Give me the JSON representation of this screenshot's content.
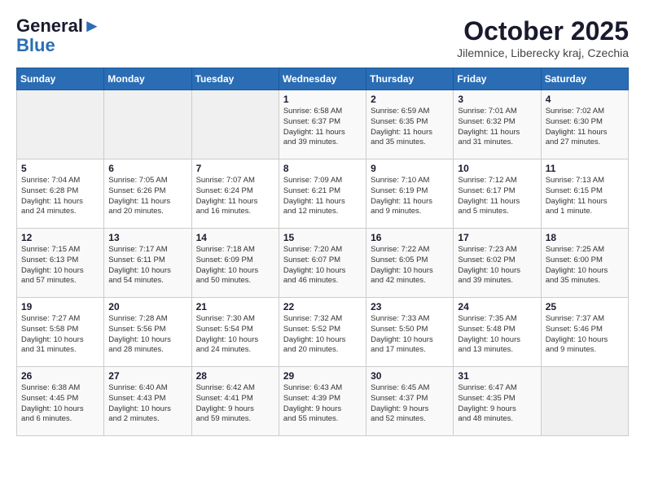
{
  "logo": {
    "line1": "General",
    "line2": "Blue"
  },
  "header": {
    "month": "October 2025",
    "location": "Jilemnice, Liberecky kraj, Czechia"
  },
  "weekdays": [
    "Sunday",
    "Monday",
    "Tuesday",
    "Wednesday",
    "Thursday",
    "Friday",
    "Saturday"
  ],
  "weeks": [
    [
      {
        "day": "",
        "info": ""
      },
      {
        "day": "",
        "info": ""
      },
      {
        "day": "",
        "info": ""
      },
      {
        "day": "1",
        "info": "Sunrise: 6:58 AM\nSunset: 6:37 PM\nDaylight: 11 hours\nand 39 minutes."
      },
      {
        "day": "2",
        "info": "Sunrise: 6:59 AM\nSunset: 6:35 PM\nDaylight: 11 hours\nand 35 minutes."
      },
      {
        "day": "3",
        "info": "Sunrise: 7:01 AM\nSunset: 6:32 PM\nDaylight: 11 hours\nand 31 minutes."
      },
      {
        "day": "4",
        "info": "Sunrise: 7:02 AM\nSunset: 6:30 PM\nDaylight: 11 hours\nand 27 minutes."
      }
    ],
    [
      {
        "day": "5",
        "info": "Sunrise: 7:04 AM\nSunset: 6:28 PM\nDaylight: 11 hours\nand 24 minutes."
      },
      {
        "day": "6",
        "info": "Sunrise: 7:05 AM\nSunset: 6:26 PM\nDaylight: 11 hours\nand 20 minutes."
      },
      {
        "day": "7",
        "info": "Sunrise: 7:07 AM\nSunset: 6:24 PM\nDaylight: 11 hours\nand 16 minutes."
      },
      {
        "day": "8",
        "info": "Sunrise: 7:09 AM\nSunset: 6:21 PM\nDaylight: 11 hours\nand 12 minutes."
      },
      {
        "day": "9",
        "info": "Sunrise: 7:10 AM\nSunset: 6:19 PM\nDaylight: 11 hours\nand 9 minutes."
      },
      {
        "day": "10",
        "info": "Sunrise: 7:12 AM\nSunset: 6:17 PM\nDaylight: 11 hours\nand 5 minutes."
      },
      {
        "day": "11",
        "info": "Sunrise: 7:13 AM\nSunset: 6:15 PM\nDaylight: 11 hours\nand 1 minute."
      }
    ],
    [
      {
        "day": "12",
        "info": "Sunrise: 7:15 AM\nSunset: 6:13 PM\nDaylight: 10 hours\nand 57 minutes."
      },
      {
        "day": "13",
        "info": "Sunrise: 7:17 AM\nSunset: 6:11 PM\nDaylight: 10 hours\nand 54 minutes."
      },
      {
        "day": "14",
        "info": "Sunrise: 7:18 AM\nSunset: 6:09 PM\nDaylight: 10 hours\nand 50 minutes."
      },
      {
        "day": "15",
        "info": "Sunrise: 7:20 AM\nSunset: 6:07 PM\nDaylight: 10 hours\nand 46 minutes."
      },
      {
        "day": "16",
        "info": "Sunrise: 7:22 AM\nSunset: 6:05 PM\nDaylight: 10 hours\nand 42 minutes."
      },
      {
        "day": "17",
        "info": "Sunrise: 7:23 AM\nSunset: 6:02 PM\nDaylight: 10 hours\nand 39 minutes."
      },
      {
        "day": "18",
        "info": "Sunrise: 7:25 AM\nSunset: 6:00 PM\nDaylight: 10 hours\nand 35 minutes."
      }
    ],
    [
      {
        "day": "19",
        "info": "Sunrise: 7:27 AM\nSunset: 5:58 PM\nDaylight: 10 hours\nand 31 minutes."
      },
      {
        "day": "20",
        "info": "Sunrise: 7:28 AM\nSunset: 5:56 PM\nDaylight: 10 hours\nand 28 minutes."
      },
      {
        "day": "21",
        "info": "Sunrise: 7:30 AM\nSunset: 5:54 PM\nDaylight: 10 hours\nand 24 minutes."
      },
      {
        "day": "22",
        "info": "Sunrise: 7:32 AM\nSunset: 5:52 PM\nDaylight: 10 hours\nand 20 minutes."
      },
      {
        "day": "23",
        "info": "Sunrise: 7:33 AM\nSunset: 5:50 PM\nDaylight: 10 hours\nand 17 minutes."
      },
      {
        "day": "24",
        "info": "Sunrise: 7:35 AM\nSunset: 5:48 PM\nDaylight: 10 hours\nand 13 minutes."
      },
      {
        "day": "25",
        "info": "Sunrise: 7:37 AM\nSunset: 5:46 PM\nDaylight: 10 hours\nand 9 minutes."
      }
    ],
    [
      {
        "day": "26",
        "info": "Sunrise: 6:38 AM\nSunset: 4:45 PM\nDaylight: 10 hours\nand 6 minutes."
      },
      {
        "day": "27",
        "info": "Sunrise: 6:40 AM\nSunset: 4:43 PM\nDaylight: 10 hours\nand 2 minutes."
      },
      {
        "day": "28",
        "info": "Sunrise: 6:42 AM\nSunset: 4:41 PM\nDaylight: 9 hours\nand 59 minutes."
      },
      {
        "day": "29",
        "info": "Sunrise: 6:43 AM\nSunset: 4:39 PM\nDaylight: 9 hours\nand 55 minutes."
      },
      {
        "day": "30",
        "info": "Sunrise: 6:45 AM\nSunset: 4:37 PM\nDaylight: 9 hours\nand 52 minutes."
      },
      {
        "day": "31",
        "info": "Sunrise: 6:47 AM\nSunset: 4:35 PM\nDaylight: 9 hours\nand 48 minutes."
      },
      {
        "day": "",
        "info": ""
      }
    ]
  ]
}
